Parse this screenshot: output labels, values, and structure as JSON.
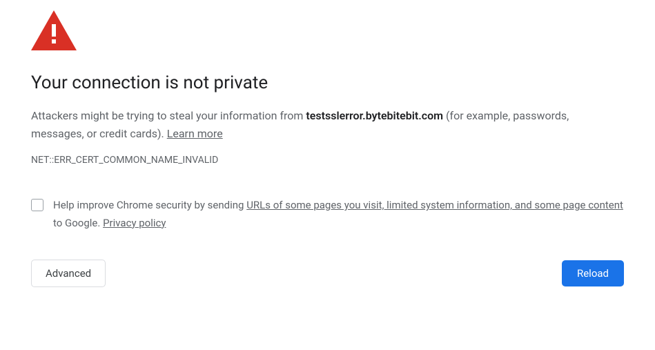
{
  "icon": {
    "color": "#d93025",
    "name": "warning-triangle"
  },
  "title": "Your connection is not private",
  "description": {
    "prefix": "Attackers might be trying to steal your information from ",
    "domain": "testsslerror.bytebitebit.com",
    "suffix": " (for example, passwords, messages, or credit cards). ",
    "learn_more": "Learn more"
  },
  "error_code": "NET::ERR_CERT_COMMON_NAME_INVALID",
  "checkbox": {
    "prefix": "Help improve Chrome security by sending ",
    "link1": "URLs of some pages you visit, limited system information, and some page content",
    "middle": " to Google. ",
    "link2": "Privacy policy"
  },
  "buttons": {
    "advanced": "Advanced",
    "reload": "Reload"
  }
}
